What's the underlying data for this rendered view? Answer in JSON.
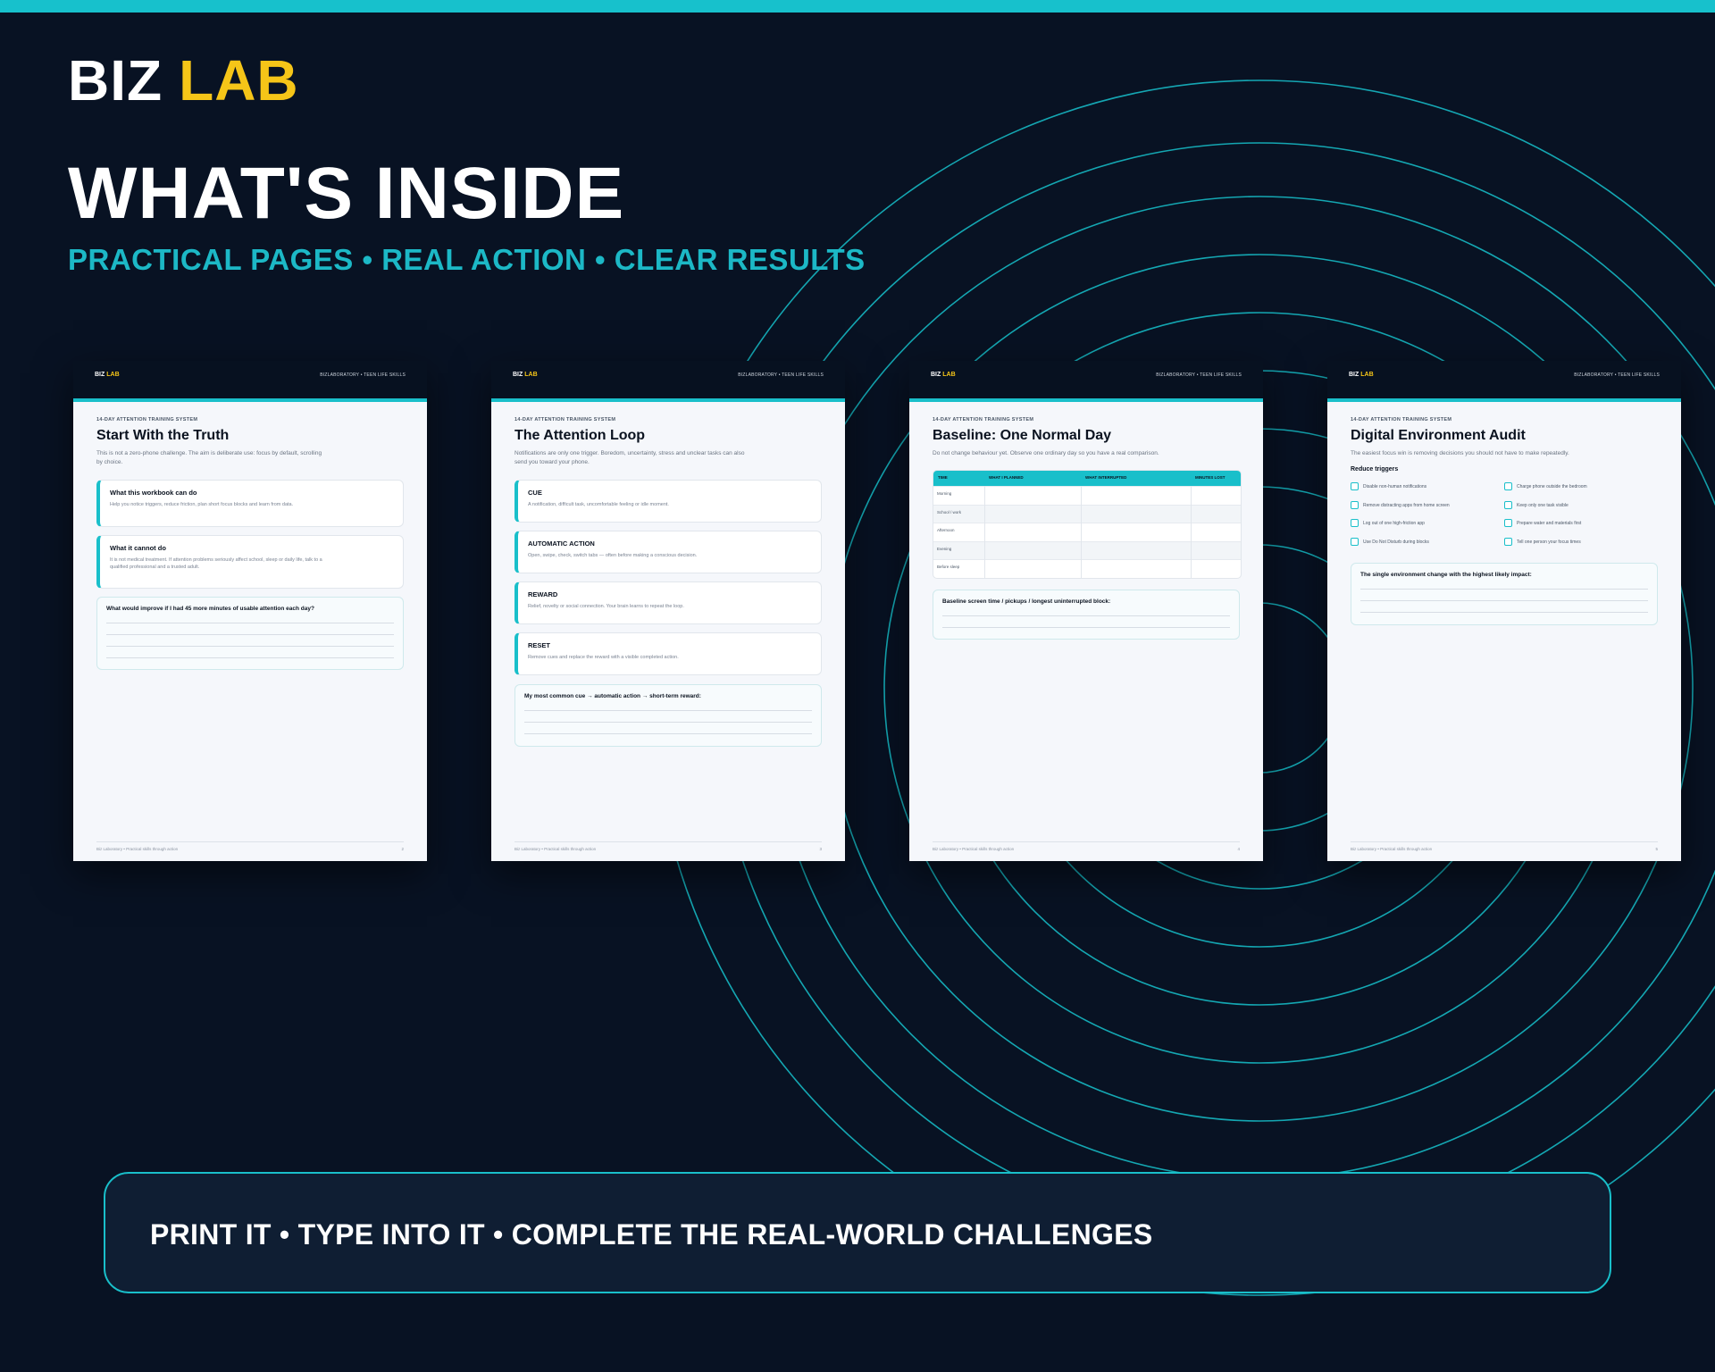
{
  "brand": {
    "word1": "BIZ",
    "word2": "LAB"
  },
  "headline": "WHAT'S INSIDE",
  "subline": "PRACTICAL PAGES • REAL ACTION • CLEAR RESULTS",
  "colors": {
    "background": "#081223",
    "accent": "#17c1cc",
    "brand_yellow": "#f5c518"
  },
  "pages": {
    "common": {
      "logo1": "BIZ",
      "logo2": "LAB",
      "tag": "BIZLABORATORY • TEEN LIFE SKILLS",
      "eyebrow": "14-DAY ATTENTION TRAINING SYSTEM",
      "footer": "Biz Laboratory • Practical skills through action"
    },
    "p1": {
      "title": "Start With the Truth",
      "intro": "This is not a zero-phone challenge. The aim is deliberate use: focus by default, scrolling by choice.",
      "number": "2",
      "cards": [
        {
          "title": "What this workbook can do",
          "body": "Help you notice triggers, reduce friction, plan short focus blocks and learn from data."
        },
        {
          "title": "What it cannot do",
          "body": "It is not medical treatment. If attention problems seriously affect school, sleep or daily life, talk to a qualified professional and a trusted adult."
        }
      ],
      "prompt": "What would improve if I had 45 more minutes of usable attention each day?"
    },
    "p2": {
      "title": "The Attention Loop",
      "intro": "Notifications are only one trigger. Boredom, uncertainty, stress and unclear tasks can also send you toward your phone.",
      "number": "3",
      "cards": [
        {
          "title": "CUE",
          "body": "A notification, difficult task, uncomfortable feeling or idle moment."
        },
        {
          "title": "AUTOMATIC ACTION",
          "body": "Open, swipe, check, switch tabs — often before making a conscious decision."
        },
        {
          "title": "REWARD",
          "body": "Relief, novelty or social connection. Your brain learns to repeat the loop."
        },
        {
          "title": "RESET",
          "body": "Remove cues and replace the reward with a visible completed action."
        }
      ],
      "prompt": "My most common cue → automatic action → short-term reward:"
    },
    "p3": {
      "title": "Baseline: One Normal Day",
      "intro": "Do not change behaviour yet. Observe one ordinary day so you have a real comparison.",
      "number": "4",
      "table": {
        "headers": [
          "TIME",
          "WHAT I PLANNED",
          "WHAT INTERRUPTED",
          "MINUTES LOST"
        ],
        "rows": [
          "Morning",
          "School / work",
          "Afternoon",
          "Evening",
          "Before sleep"
        ]
      },
      "prompt": "Baseline screen time / pickups / longest uninterrupted block:"
    },
    "p4": {
      "title": "Digital Environment Audit",
      "intro": "The easiest focus win is removing decisions you should not have to make repeatedly.",
      "number": "5",
      "section": "Reduce triggers",
      "checks_left": [
        "Disable non-human notifications",
        "Remove distracting apps from home screen",
        "Log out of one high-friction app",
        "Use Do Not Disturb during blocks"
      ],
      "checks_right": [
        "Charge phone outside the bedroom",
        "Keep only one task visible",
        "Prepare water and materials first",
        "Tell one person your focus times"
      ],
      "prompt": "The single environment change with the highest likely impact:"
    }
  },
  "banner": "PRINT IT • TYPE INTO IT • COMPLETE THE REAL-WORLD CHALLENGES"
}
